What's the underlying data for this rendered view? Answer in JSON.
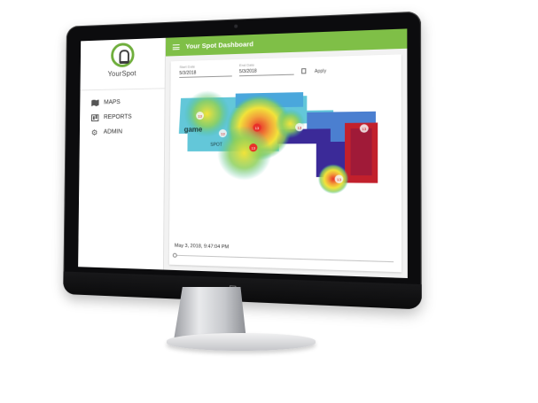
{
  "app": {
    "brand_name": "YourSpot",
    "header_title": "Your Spot Dashboard"
  },
  "sidebar": {
    "items": [
      {
        "label": "MAPS",
        "icon": "map-icon"
      },
      {
        "label": "REPORTS",
        "icon": "report-icon"
      },
      {
        "label": "ADMIN",
        "icon": "gear-icon"
      }
    ]
  },
  "filters": {
    "start_label": "Start Date",
    "start_value": "5/3/2018",
    "end_label": "End Date",
    "end_value": "5/3/2018",
    "apply_label": "Apply"
  },
  "map": {
    "store_label_1": "game",
    "store_label_2": "SPOT",
    "hotspot_numbers": [
      "13",
      "13",
      "13",
      "13",
      "13",
      "13",
      "13"
    ]
  },
  "timeline": {
    "timestamp": "May 3, 2018, 9:47:04 PM",
    "position_fraction": 0.0
  },
  "colors": {
    "accent": "#7fbf47",
    "heat_high": "#e8312a",
    "heat_mid": "#f2e33a",
    "heat_low": "#3fbe9b",
    "floor_purple": "#3b2a98",
    "floor_red": "#c2202c"
  }
}
